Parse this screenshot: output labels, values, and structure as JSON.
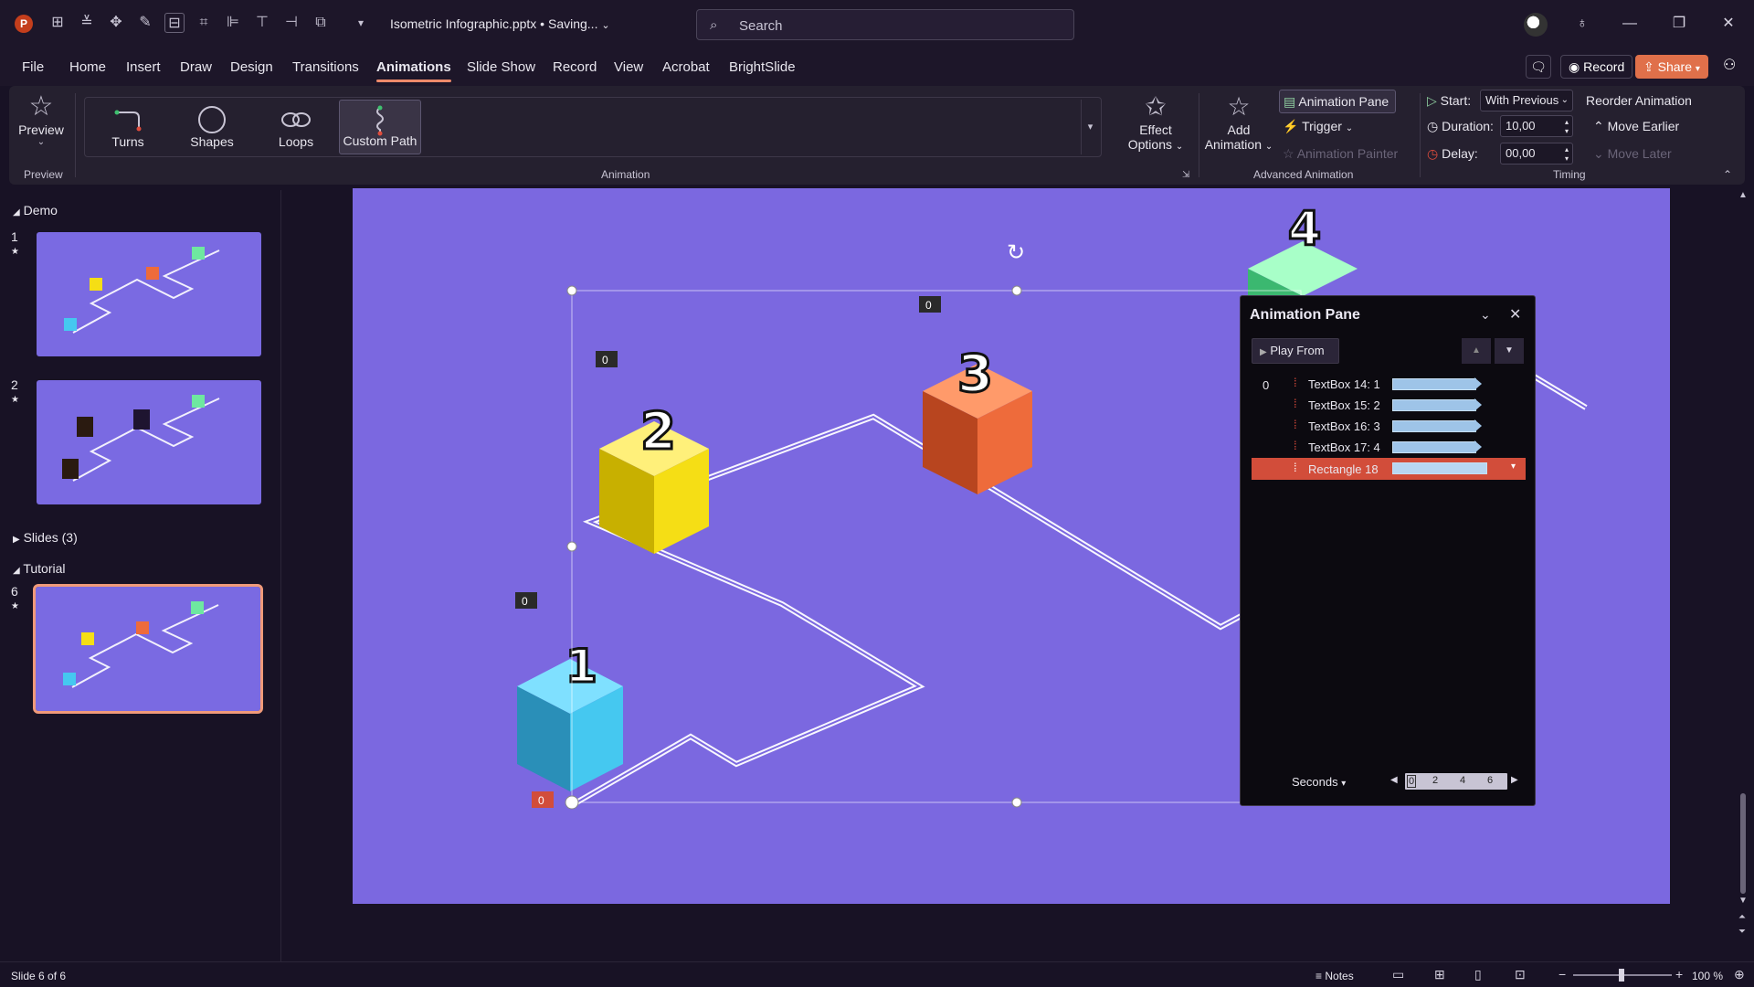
{
  "titlebar": {
    "app_logo": "P",
    "document_title": "Isometric Infographic.pptx • Saving...",
    "search_placeholder": "Search"
  },
  "menu": {
    "tabs": [
      "File",
      "Home",
      "Insert",
      "Draw",
      "Design",
      "Transitions",
      "Animations",
      "Slide Show",
      "Record",
      "View",
      "Acrobat",
      "BrightSlide"
    ],
    "active_tab": "Animations",
    "record_label": "Record",
    "share_label": "Share"
  },
  "ribbon": {
    "preview": {
      "button_label": "Preview",
      "group_label": "Preview"
    },
    "animation_gallery": {
      "items": [
        "Turns",
        "Shapes",
        "Loops",
        "Custom Path"
      ],
      "selected": "Custom Path",
      "group_label": "Animation"
    },
    "effect_options": {
      "line1": "Effect",
      "line2": "Options"
    },
    "advanced": {
      "add_animation_line1": "Add",
      "add_animation_line2": "Animation",
      "animation_pane": "Animation Pane",
      "trigger": "Trigger",
      "animation_painter": "Animation Painter",
      "group_label": "Advanced Animation"
    },
    "timing": {
      "start_label": "Start:",
      "start_value": "With Previous",
      "duration_label": "Duration:",
      "duration_value": "10,00",
      "delay_label": "Delay:",
      "delay_value": "00,00",
      "reorder_title": "Reorder Animation",
      "move_earlier": "Move Earlier",
      "move_later": "Move Later",
      "group_label": "Timing"
    }
  },
  "slide_panel": {
    "sections": [
      {
        "name": "Demo",
        "expanded": true
      },
      {
        "name": "Slides (3)",
        "expanded": false
      },
      {
        "name": "Tutorial",
        "expanded": true
      }
    ],
    "thumbnails": [
      {
        "number": "1",
        "selected": false
      },
      {
        "number": "2",
        "selected": false
      },
      {
        "number": "6",
        "selected": true
      }
    ]
  },
  "slide": {
    "cube_labels": [
      "1",
      "2",
      "3",
      "4"
    ],
    "tags": [
      "0",
      "0",
      "0",
      "0"
    ]
  },
  "animation_pane": {
    "title": "Animation Pane",
    "play_from": "Play From",
    "start_index": "0",
    "items": [
      {
        "name": "TextBox 14: 1",
        "selected": false
      },
      {
        "name": "TextBox 15: 2",
        "selected": false
      },
      {
        "name": "TextBox 16: 3",
        "selected": false
      },
      {
        "name": "TextBox 17: 4",
        "selected": false
      },
      {
        "name": "Rectangle 18",
        "selected": true
      }
    ],
    "seconds_label": "Seconds",
    "timeline_ticks": [
      "0",
      "2",
      "4",
      "6"
    ]
  },
  "statusbar": {
    "slide_info": "Slide 6 of 6",
    "notes": "Notes",
    "zoom": "100 %"
  },
  "colors": {
    "slide_bg": "#7b68e0",
    "accent": "#ee8a6a",
    "selection": "#d24d3a",
    "cube_blue": "#45c8f0",
    "cube_yellow": "#f5de15",
    "cube_orange": "#ee6b3b",
    "cube_green": "#6ee8a0"
  }
}
